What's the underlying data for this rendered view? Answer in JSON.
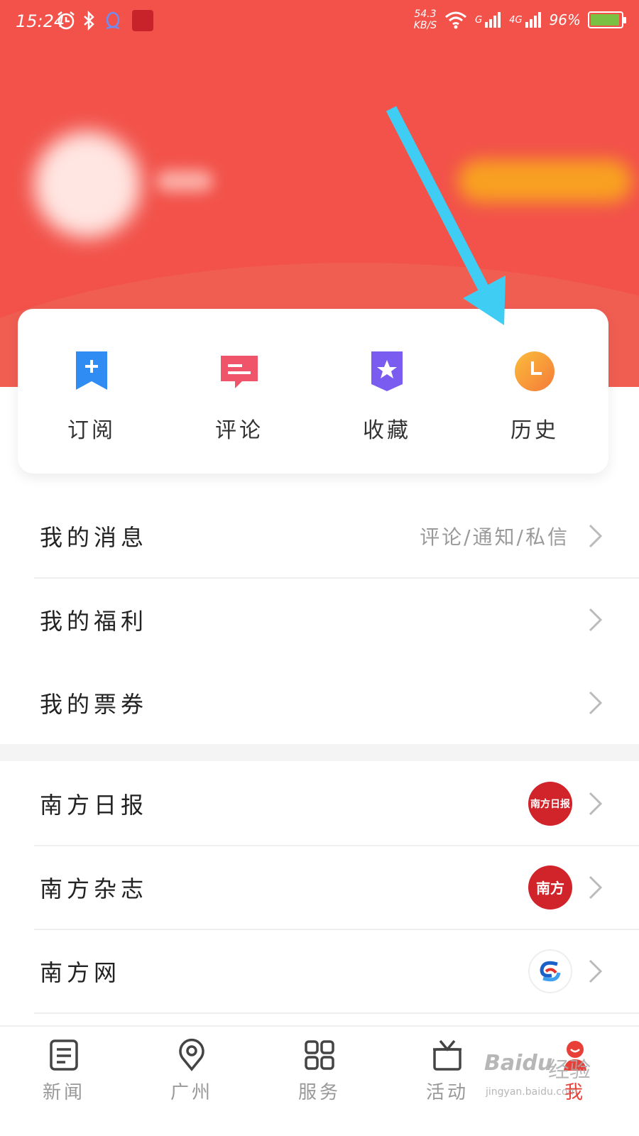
{
  "status_bar": {
    "time": "15:24",
    "net_speed_value": "54.3",
    "net_speed_unit": "KB/S",
    "signal_1_label": "G",
    "signal_2_label": "4G",
    "battery": "96%",
    "battery_level": 0.96
  },
  "quick_actions": [
    {
      "label": "订阅",
      "icon": "subscribe-bookmark-icon",
      "color": "#2f8cf2"
    },
    {
      "label": "评论",
      "icon": "comment-bubble-icon",
      "color": "#f0546a"
    },
    {
      "label": "收藏",
      "icon": "favorite-star-shield-icon",
      "color": "#7a5cf0"
    },
    {
      "label": "历史",
      "icon": "history-clock-icon",
      "color": "#f7a436"
    }
  ],
  "menu": {
    "messages": {
      "label": "我的消息",
      "extra": "评论/通知/私信"
    },
    "welfare": {
      "label": "我的福利"
    },
    "tickets": {
      "label": "我的票券"
    }
  },
  "brands": [
    {
      "label": "南方日报",
      "logo_text": "南方日报"
    },
    {
      "label": "南方杂志",
      "logo_text": "南方"
    },
    {
      "label": "南方网",
      "logo_text": ""
    }
  ],
  "bottom_nav": [
    {
      "label": "新闻",
      "icon": "news-icon",
      "active": false
    },
    {
      "label": "广州",
      "icon": "location-pin-icon",
      "active": false
    },
    {
      "label": "服务",
      "icon": "grid-services-icon",
      "active": false
    },
    {
      "label": "活动",
      "icon": "gift-box-icon",
      "active": false
    },
    {
      "label": "我",
      "icon": "profile-icon",
      "active": true
    }
  ],
  "watermark": {
    "brand": "Baidu",
    "sub": "经验",
    "url": "jingyan.baidu.com"
  },
  "colors": {
    "header": "#f2524a",
    "accent": "#e84038",
    "arrow": "#3fcdf3"
  }
}
